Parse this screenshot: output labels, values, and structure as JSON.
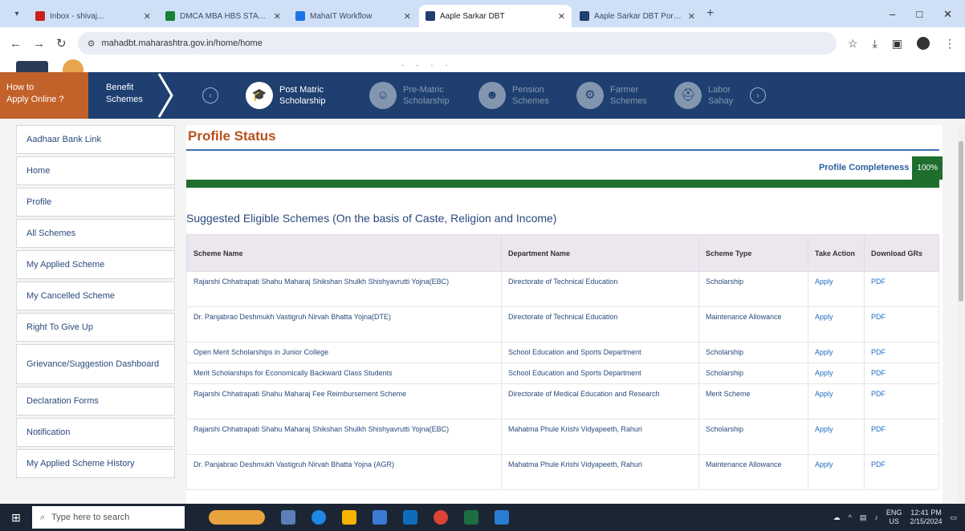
{
  "browser": {
    "tabs": [
      {
        "label": "Inbox - shivaj...",
        "fav_color": "#c5221f",
        "active": false
      },
      {
        "label": "DMCA MBA HBS STATUS",
        "fav_color": "#188038",
        "active": false
      },
      {
        "label": "MahaIT Workflow",
        "fav_color": "#1a73e8",
        "active": false
      },
      {
        "label": "Aaple Sarkar DBT",
        "fav_color": "#1e3f6f",
        "active": true
      },
      {
        "label": "Aaple Sarkar DBT Portal for...",
        "fav_color": "#1e3f6f",
        "active": false
      }
    ],
    "url": "mahadbt.maharashtra.gov.in/home/home",
    "icons": [
      "back-arrow-icon",
      "forward-arrow-icon",
      "reload-icon",
      "star-icon",
      "download-icon",
      "sidepanel-icon",
      "profile-icon",
      "menu-dots-icon"
    ]
  },
  "header_sliver": {
    "text": "· · · ·"
  },
  "scheme_nav": {
    "how_to_line1": "How to",
    "how_to_line2": "Apply Online ?",
    "benefit_line1": "Benefit",
    "benefit_line2": "Schemes",
    "items": [
      {
        "line1": "Post Matric",
        "line2": "Scholarship",
        "icon": "graduation-cap-icon",
        "active": true
      },
      {
        "line1": "Pre-Matric",
        "line2": "Scholarship",
        "icon": "child-icon",
        "active": false
      },
      {
        "line1": "Pension",
        "line2": "Schemes",
        "icon": "elderly-icon",
        "active": false
      },
      {
        "line1": "Farmer",
        "line2": "Schemes",
        "icon": "tractor-icon",
        "active": false
      },
      {
        "line1": "Labor",
        "line2": "Sahay",
        "icon": "worker-icon",
        "active": false
      }
    ]
  },
  "sidebar": {
    "items": [
      {
        "label": "Aadhaar Bank Link"
      },
      {
        "label": "Home"
      },
      {
        "label": "Profile"
      },
      {
        "label": "All Schemes"
      },
      {
        "label": "My Applied Scheme"
      },
      {
        "label": "My Cancelled Scheme"
      },
      {
        "label": "Right To Give Up"
      },
      {
        "label": "Grievance/Suggestion Dashboard"
      },
      {
        "label": "Declaration Forms"
      },
      {
        "label": "Notification"
      },
      {
        "label": "My Applied Scheme History"
      }
    ]
  },
  "main": {
    "title": "Profile Status",
    "completeness_label": "Profile Completeness",
    "completeness_value": "100%",
    "completeness_fraction": 1.0,
    "suggested_heading": "Suggested Eligible Schemes (On the basis of Caste, Religion and Income)",
    "table": {
      "headers": [
        "Scheme Name",
        "Department Name",
        "Scheme Type",
        "Take Action",
        "Download GRs"
      ],
      "rows": [
        {
          "name": "Rajarshi Chhatrapati Shahu Maharaj Shikshan Shulkh Shishyavrutti Yojna(EBC)",
          "dept": "Directorate of Technical Education",
          "type": "Scholarship",
          "action": "Apply",
          "gr": "PDF"
        },
        {
          "name": "Dr. Panjabrao Deshmukh Vastigruh Nirvah Bhatta Yojna(DTE)",
          "dept": "Directorate of Technical Education",
          "type": "Maintenance Allowance",
          "action": "Apply",
          "gr": "PDF"
        },
        {
          "name": "Open Merit Scholarships in Junior College",
          "dept": "School Education and Sports Department",
          "type": "Scholarship",
          "action": "Apply",
          "gr": "PDF"
        },
        {
          "name": "Merit Scholarships for Economically Backward Class Students",
          "dept": "School Education and Sports Department",
          "type": "Scholarship",
          "action": "Apply",
          "gr": "PDF"
        },
        {
          "name": "Rajarshi Chhatrapati Shahu Maharaj Fee Reimbursement Scheme",
          "dept": "Directorate of Medical Education and Research",
          "type": "Merit Scheme",
          "action": "Apply",
          "gr": "PDF"
        },
        {
          "name": "Rajarshi Chhatrapati Shahu Maharaj Shikshan Shulkh Shishyavrutti Yojna(EBC)",
          "dept": "Mahatma Phule Krishi Vidyapeeth, Rahuri",
          "type": "Scholarship",
          "action": "Apply",
          "gr": "PDF"
        },
        {
          "name": "Dr. Panjabrao Deshmukh Vastigruh Nirvah Bhatta Yojna (AGR)",
          "dept": "Mahatma Phule Krishi Vidyapeeth, Rahuri",
          "type": "Maintenance Allowance",
          "action": "Apply",
          "gr": "PDF"
        }
      ]
    }
  },
  "taskbar": {
    "search_placeholder": "Type here to search",
    "lang_line1": "ENG",
    "lang_line2": "US",
    "time": "12:41 PM",
    "date": "2/15/2024"
  }
}
